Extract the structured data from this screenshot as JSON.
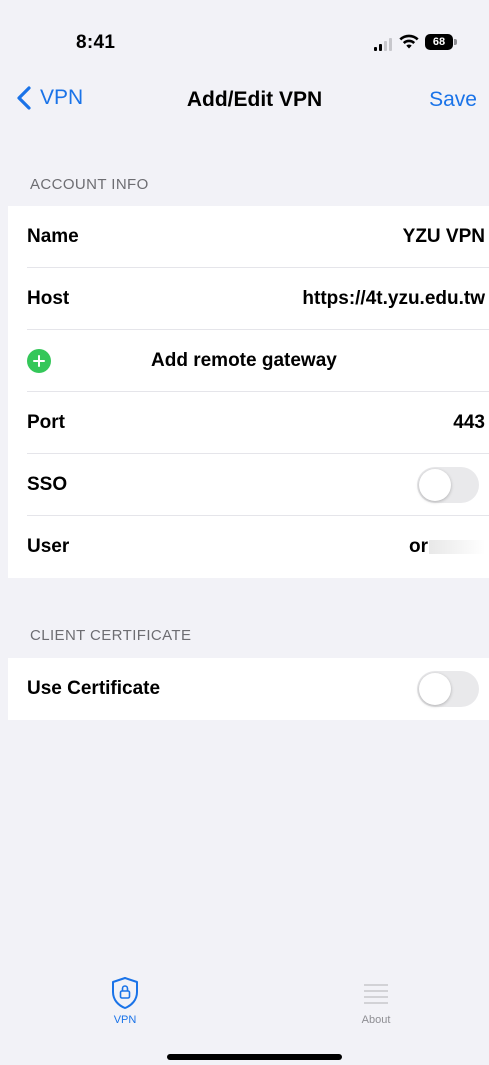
{
  "status_bar": {
    "time": "8:41",
    "battery": "68"
  },
  "nav": {
    "back_label": "VPN",
    "title": "Add/Edit VPN",
    "save_label": "Save"
  },
  "account_info": {
    "header": "ACCOUNT INFO",
    "name_label": "Name",
    "name_value": "YZU VPN",
    "host_label": "Host",
    "host_value": "https://4t.yzu.edu.tw",
    "add_gateway_label": "Add remote gateway",
    "port_label": "Port",
    "port_value": "443",
    "sso_label": "SSO",
    "sso_on": false,
    "user_label": "User",
    "user_value": "or"
  },
  "client_certificate": {
    "header": "CLIENT CERTIFICATE",
    "use_certificate_label": "Use Certificate",
    "use_certificate_on": false
  },
  "tab_bar": {
    "vpn_label": "VPN",
    "about_label": "About"
  },
  "colors": {
    "accent": "#1a73e8",
    "add_green": "#34c759",
    "background": "#f2f2f7",
    "toggle_off": "#e9e9eb"
  }
}
